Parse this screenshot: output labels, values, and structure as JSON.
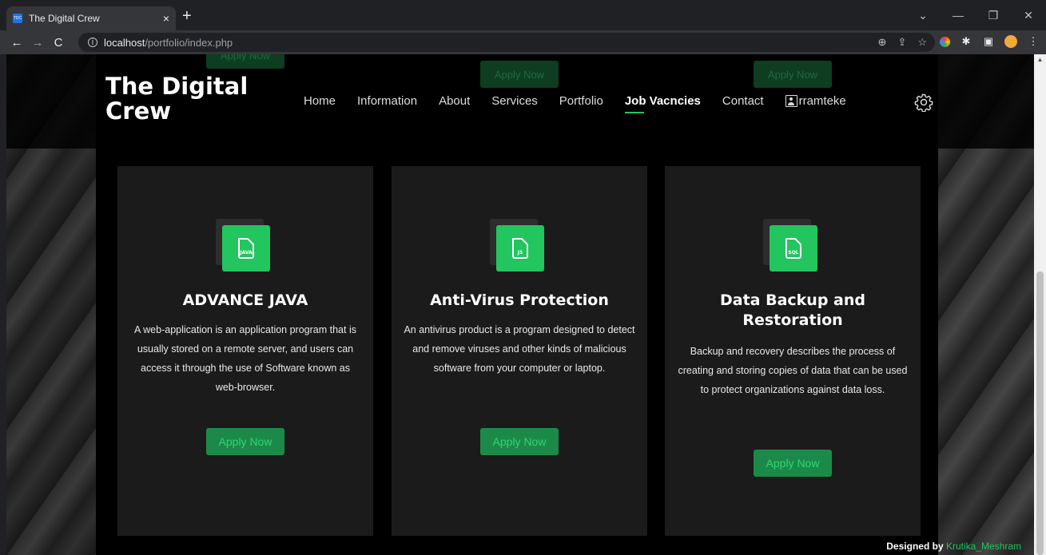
{
  "browser": {
    "tab_title": "The Digital Crew",
    "favicon_text": "TDC",
    "tab_close": "×",
    "new_tab": "+",
    "url_host": "localhost",
    "url_path": "/portfolio/index.php",
    "win_min": "—",
    "win_restore": "❐",
    "win_close": "✕",
    "win_more": "⌄"
  },
  "header": {
    "logo": "The Digital Crew",
    "nav": [
      "Home",
      "Information",
      "About",
      "Services",
      "Portfolio",
      "Job Vacncies",
      "Contact"
    ],
    "active_nav": "Job Vacncies",
    "username": "rramteke",
    "ghost_buttons": [
      "Apply Now",
      "Apply Now",
      "Apply Now"
    ]
  },
  "cards": [
    {
      "icon_label": "JAVA",
      "title": "ADVANCE JAVA",
      "description": "A web-application is an application program that is usually stored on a remote server, and users can access it through the use of Software known as web-browser.",
      "button": "Apply Now"
    },
    {
      "icon_label": "JS",
      "title": "Anti-Virus Protection",
      "description": "An antivirus product is a program designed to detect and remove viruses and other kinds of malicious software from your computer or laptop.",
      "button": "Apply Now"
    },
    {
      "icon_label": "SQL",
      "title": "Data Backup and Restoration",
      "description": "Backup and recovery describes the process of creating and storing copies of data that can be used to protect organizations against data loss.",
      "button": "Apply Now"
    }
  ],
  "footer": {
    "prefix": "Designed by",
    "author": "Krutika_Meshram"
  },
  "colors": {
    "accent": "#22c55e",
    "card_bg": "#1b1b1b",
    "button_bg": "#1b8a48"
  }
}
